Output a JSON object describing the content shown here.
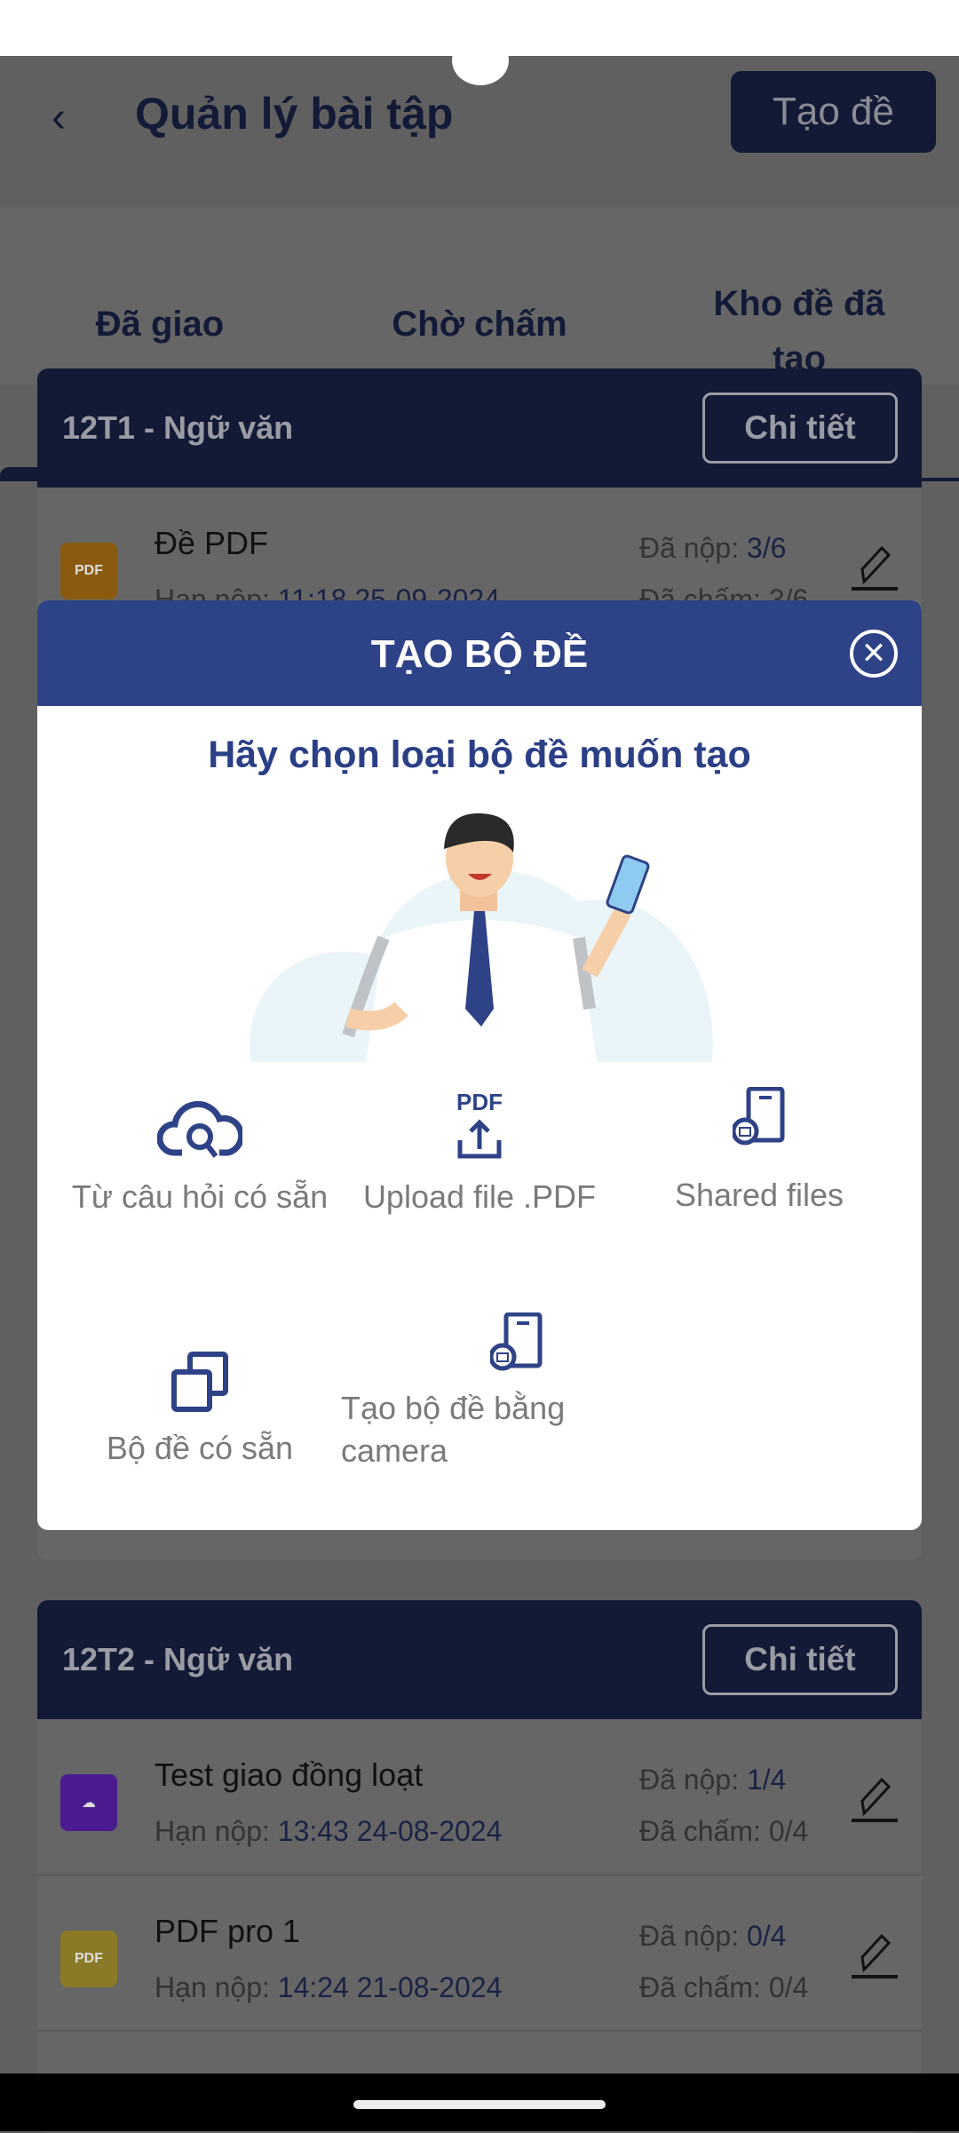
{
  "header": {
    "title": "Quản lý bài tập",
    "create_button": "Tạo đề"
  },
  "tabs": [
    {
      "label": "Đã giao",
      "active": true
    },
    {
      "label": "Chờ chấm"
    },
    {
      "label": "Kho đề đã tạo"
    }
  ],
  "classes": [
    {
      "name": "12T1 - Ngữ văn",
      "detail_button": "Chi tiết",
      "items": [
        {
          "title": "Đề PDF",
          "due_label": "Hạn nộp:",
          "due": "11:18 25-09-2024",
          "submitted_label": "Đã nộp:",
          "submitted": "3/6",
          "graded_label": "Đã chấm:",
          "graded": "3/6",
          "icon": "pdf-icon",
          "icon_color": "#e8a020"
        }
      ]
    },
    {
      "name": "12T2 - Ngữ văn",
      "detail_button": "Chi tiết",
      "items": [
        {
          "title": "Test giao đồng loạt",
          "due_label": "Hạn nộp:",
          "due": "13:43 24-08-2024",
          "submitted_label": "Đã nộp:",
          "submitted": "1/4",
          "graded_label": "Đã chấm:",
          "graded": "0/4",
          "icon": "cloud-scan-icon",
          "icon_color": "#7b2ff0"
        },
        {
          "title": "PDF pro 1",
          "due_label": "Hạn nộp:",
          "due": "14:24 21-08-2024",
          "submitted_label": "Đã nộp:",
          "submitted": "0/4",
          "graded_label": "Đã chấm:",
          "graded": "0/4",
          "icon": "pdf-icon",
          "icon_color": "#f0d040"
        }
      ]
    }
  ],
  "modal": {
    "title": "TẠO BỘ ĐỀ",
    "subtitle": "Hãy chọn loại bộ đề muốn tạo",
    "options": [
      {
        "label": "Từ câu hỏi có sẵn",
        "icon": "cloud-search-icon"
      },
      {
        "label": "Upload file .PDF",
        "icon": "pdf-upload-icon"
      },
      {
        "label": "Shared files",
        "icon": "phone-camera-icon"
      },
      {
        "label": "Bộ đề có sẵn",
        "icon": "copy-icon"
      },
      {
        "label": "Tạo bộ đề bằng camera",
        "icon": "phone-camera-icon"
      }
    ],
    "pdf_glyph": "PDF"
  },
  "colors": {
    "primary": "#2e4287",
    "overlay": "rgba(0,0,0,0.6)"
  }
}
